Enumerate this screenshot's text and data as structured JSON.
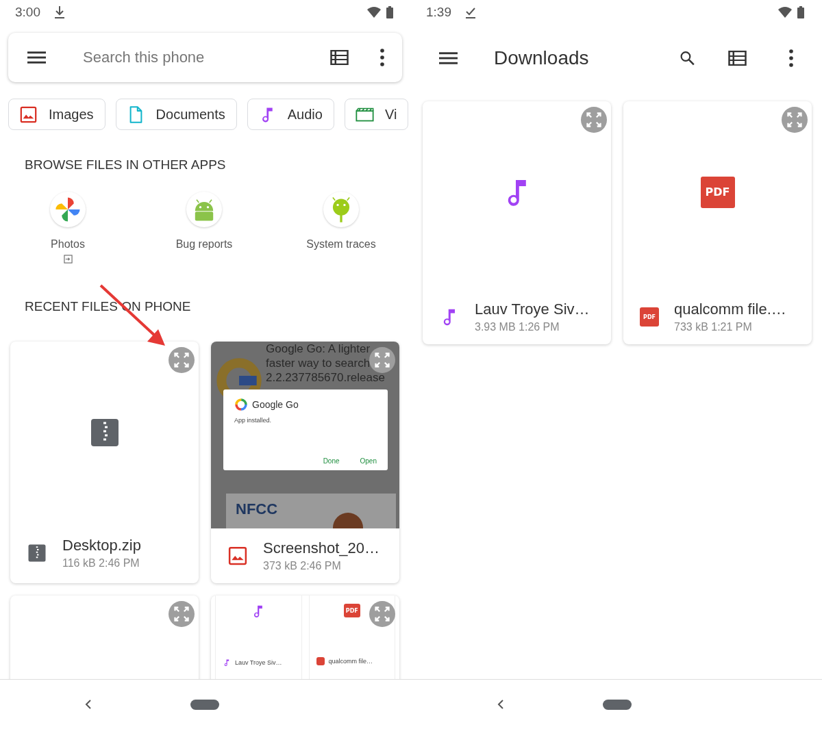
{
  "left_screen": {
    "status_bar": {
      "time": "3:00"
    },
    "search": {
      "placeholder": "Search this phone"
    },
    "chips": [
      {
        "label": "Images",
        "kind": "images"
      },
      {
        "label": "Documents",
        "kind": "documents"
      },
      {
        "label": "Audio",
        "kind": "audio"
      },
      {
        "label": "Vi",
        "kind": "videos"
      }
    ],
    "browse_heading": "BROWSE FILES IN OTHER APPS",
    "apps": [
      {
        "label": "Photos",
        "kind": "photos",
        "external": true
      },
      {
        "label": "Bug reports",
        "kind": "bug",
        "external": false
      },
      {
        "label": "System traces",
        "kind": "traces",
        "external": false
      }
    ],
    "recent_heading": "RECENT FILES ON PHONE",
    "recent_files": [
      {
        "kind": "zip",
        "name": "Desktop.zip",
        "details": "116 kB 2:46 PM"
      },
      {
        "kind": "screenshot",
        "name": "Screenshot_20…",
        "details": "373 kB 2:46 PM",
        "preview": {
          "background_lines": [
            "Google Go: A lighter",
            "faster way to search",
            "2.2.237785670.release"
          ],
          "dialog": {
            "app": "Google Go",
            "message": "App installed.",
            "actions": [
              "Done",
              "Open"
            ]
          },
          "ad_brand": "NFCC"
        }
      },
      {
        "kind": "blank"
      },
      {
        "kind": "mini_grid",
        "items": [
          {
            "kind": "audio",
            "name": "Lauv  Troye Siv…"
          },
          {
            "kind": "pdf",
            "name": "qualcomm file…",
            "icon_label": "PDF"
          }
        ]
      }
    ]
  },
  "right_screen": {
    "status_bar": {
      "time": "1:39"
    },
    "title": "Downloads",
    "files": [
      {
        "kind": "audio",
        "name": "Lauv  Troye Siv…",
        "details": "3.93 MB 1:26 PM"
      },
      {
        "kind": "pdf",
        "name": "qualcomm file.…",
        "details": "733 kB 1:21 PM",
        "icon_label": "PDF",
        "small_icon_label": "PDF"
      }
    ]
  }
}
